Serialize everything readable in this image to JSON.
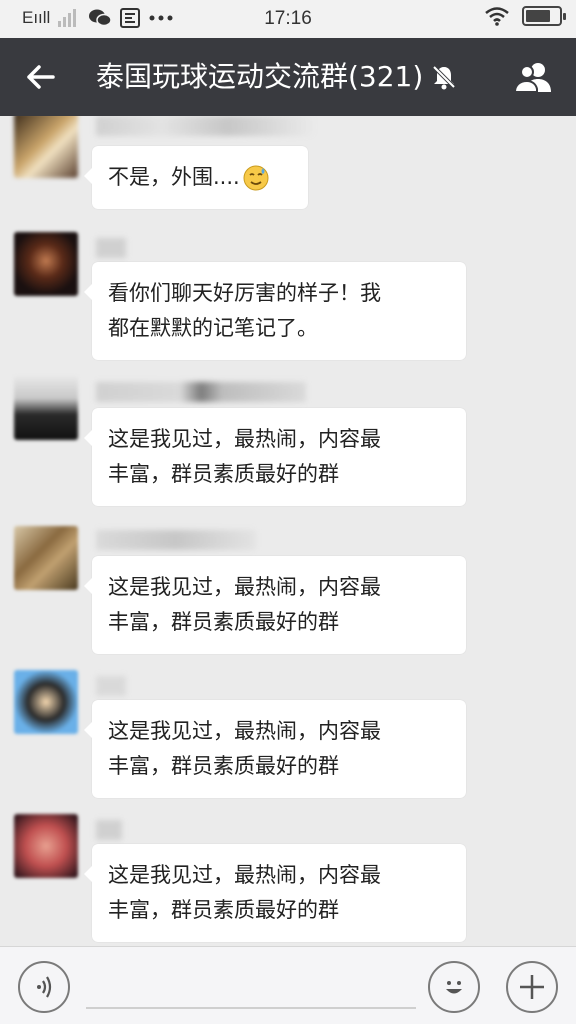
{
  "status_bar": {
    "carrier": "Eııll",
    "time": "17:16",
    "battery_level": 0.75,
    "icons": [
      "signal-icon",
      "wechat-icon",
      "notification-icon",
      "more-dots-icon",
      "wifi-icon",
      "battery-icon"
    ]
  },
  "header": {
    "title": "泰国玩球运动交流群(321)",
    "muted": true,
    "icons": [
      "back-arrow-icon",
      "mute-bell-icon",
      "group-members-icon"
    ]
  },
  "messages": [
    {
      "line1": "不是，外围....",
      "line2": "",
      "has_emoji": true
    },
    {
      "line1": "看你们聊天好厉害的样子！我",
      "line2": "都在默默的记笔记了。",
      "has_emoji": false
    },
    {
      "line1": "这是我见过，最热闹，内容最",
      "line2": "丰富，群员素质最好的群",
      "has_emoji": false
    },
    {
      "line1": "这是我见过，最热闹，内容最",
      "line2": "丰富，群员素质最好的群",
      "has_emoji": false
    },
    {
      "line1": "这是我见过，最热闹，内容最",
      "line2": "丰富，群员素质最好的群",
      "has_emoji": false
    },
    {
      "line1": "这是我见过，最热闹，内容最",
      "line2": "丰富，群员素质最好的群",
      "has_emoji": false
    }
  ],
  "input_bar": {
    "value": "",
    "placeholder": "",
    "icons": [
      "voice-icon",
      "emoji-icon",
      "plus-icon"
    ]
  },
  "colors": {
    "header_bg": "#393a3f",
    "chat_bg": "#ebebeb",
    "bubble_bg": "#ffffff"
  }
}
